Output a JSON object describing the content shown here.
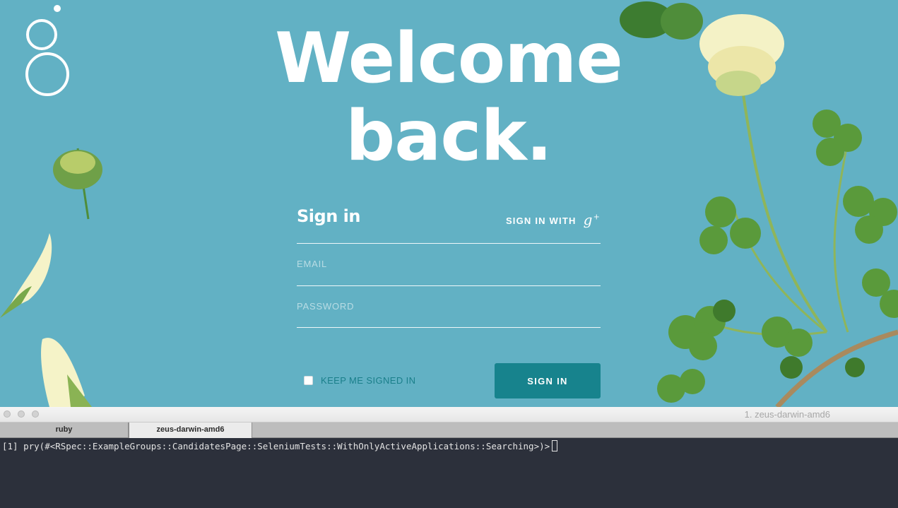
{
  "page": {
    "headline_line1": "Welcome",
    "headline_line2": "back.",
    "signin_title": "Sign in",
    "google_signin_label": "SIGN IN WITH",
    "google_icon_glyph": "g",
    "google_icon_plus": "+",
    "email_placeholder": "EMAIL",
    "password_placeholder": "PASSWORD",
    "keep_signed_in_label": "KEEP ME SIGNED IN",
    "signin_button_label": "SIGN IN",
    "colors": {
      "background": "#62b1c4",
      "button": "#17838d",
      "checkbox_label": "#1a7f8a"
    }
  },
  "terminal": {
    "window_title": "1. zeus-darwin-amd6",
    "tabs": [
      {
        "label": "ruby",
        "active": false
      },
      {
        "label": "zeus-darwin-amd6",
        "active": true
      }
    ],
    "prompt_line": "[1] pry(#<RSpec::ExampleGroups::CandidatesPage::SeleniumTests::WithOnlyActiveApplications::Searching>)>",
    "colors": {
      "background": "#2c303b",
      "text": "#e3e3e3"
    }
  }
}
